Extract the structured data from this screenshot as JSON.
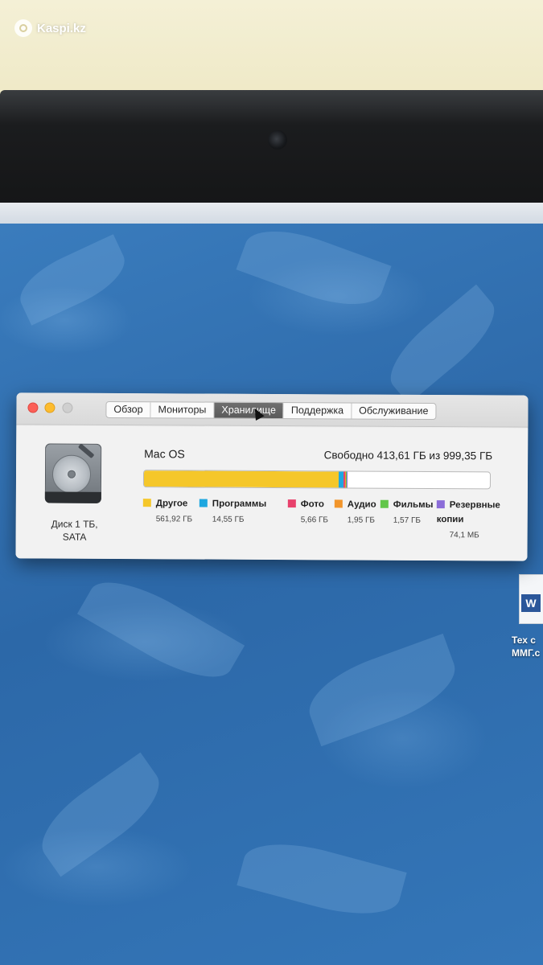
{
  "watermark": {
    "text": "Kaspi.kz"
  },
  "window": {
    "tabs": [
      {
        "label": "Обзор",
        "active": false
      },
      {
        "label": "Мониторы",
        "active": false
      },
      {
        "label": "Хранилище",
        "active": true
      },
      {
        "label": "Поддержка",
        "active": false
      },
      {
        "label": "Обслуживание",
        "active": false
      }
    ],
    "disk": {
      "name_line1": "Диск 1 ТБ,",
      "name_line2": "SATA"
    },
    "volume": {
      "name": "Mac OS",
      "free_text": "Свободно 413,61 ГБ из 999,35 ГБ",
      "total_gb": 999.35,
      "free_gb": 413.61
    },
    "categories": [
      {
        "name": "Другое",
        "size": "561,92 ГБ",
        "gb": 561.92,
        "color": "#f5c72a"
      },
      {
        "name": "Программы",
        "size": "14,55 ГБ",
        "gb": 14.55,
        "color": "#1ea7e0"
      },
      {
        "name": "Фото",
        "size": "5,66 ГБ",
        "gb": 5.66,
        "color": "#e8416c"
      },
      {
        "name": "Аудио",
        "size": "1,95 ГБ",
        "gb": 1.95,
        "color": "#f2952b"
      },
      {
        "name": "Фильмы",
        "size": "1,57 ГБ",
        "gb": 1.57,
        "color": "#62c64a"
      },
      {
        "name": "Резервные копии",
        "size": "74,1 МБ",
        "gb": 0.0741,
        "color": "#8b6cd8"
      }
    ]
  },
  "desktop_file": {
    "label_line1": "Тех с",
    "label_line2": "ММГ.с"
  }
}
